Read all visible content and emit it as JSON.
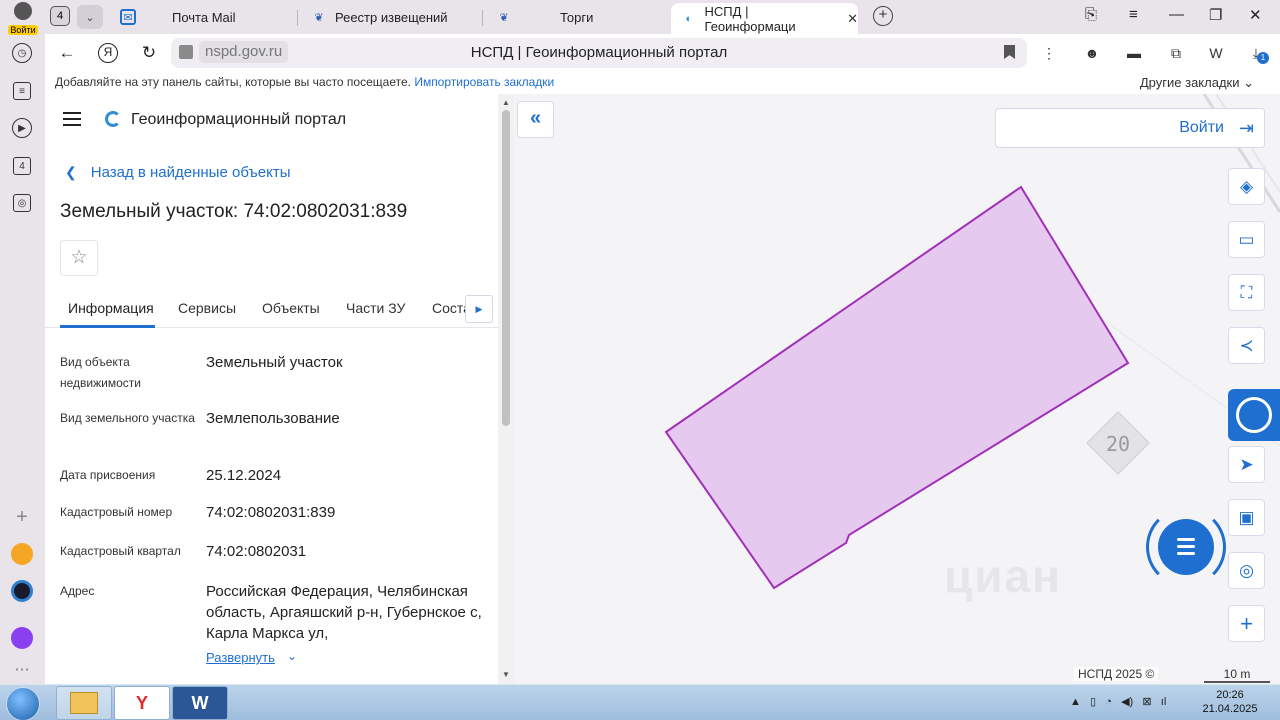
{
  "browser": {
    "login_label": "Войти",
    "tab_count": "4",
    "tabs": [
      {
        "label": "Почта Mail",
        "icon": "mail-icon"
      },
      {
        "label": "Реестр извещений",
        "icon": "emblem-icon"
      },
      {
        "label": "Торги",
        "icon": "emblem-icon"
      },
      {
        "label": "НСПД | Геоинформаци",
        "icon": "nspd-icon",
        "active": true
      }
    ],
    "address": {
      "domain": "nspd.gov.ru",
      "title": "НСПД | Геоинформационный портал"
    },
    "bookmarks_hint": "Добавляйте на эту панель сайты, которые вы часто посещаете.",
    "bookmarks_import": "Импортировать закладки",
    "other_bookmarks": "Другие закладки",
    "rail_badge": "4",
    "extension_badge": "1"
  },
  "panel": {
    "portal_title": "Геоинформационный портал",
    "back_label": "Назад в найденные объекты",
    "object_title": "Земельный участок: 74:02:0802031:839",
    "tabs": [
      "Информация",
      "Сервисы",
      "Объекты",
      "Части ЗУ",
      "Соста"
    ],
    "active_tab": "Информация",
    "fields": [
      {
        "label": "Вид объекта недвижимости",
        "value": "Земельный участок"
      },
      {
        "label": "Вид земельного участка",
        "value": "Землепользование"
      },
      {
        "label": "Дата присвоения",
        "value": "25.12.2024"
      },
      {
        "label": "Кадастровый номер",
        "value": "74:02:0802031:839"
      },
      {
        "label": "Кадастровый квартал",
        "value": "74:02:0802031"
      },
      {
        "label": "Адрес",
        "value": "Российская Федерация, Челябинская область, Аргаяшский р-н, Губернское с, Карла Маркса ул,"
      }
    ],
    "expand_label": "Развернуть"
  },
  "map": {
    "login_label": "Войти",
    "road_badge": "20",
    "attribution": "НСПД 2025 ©",
    "scale": "10 m",
    "parcel_fill": "#e6c9ee",
    "parcel_stroke": "#a030b8",
    "accent": "#1e6fcf",
    "watermark": "циан"
  },
  "taskbar": {
    "time": "20:26",
    "date": "21.04.2025"
  }
}
